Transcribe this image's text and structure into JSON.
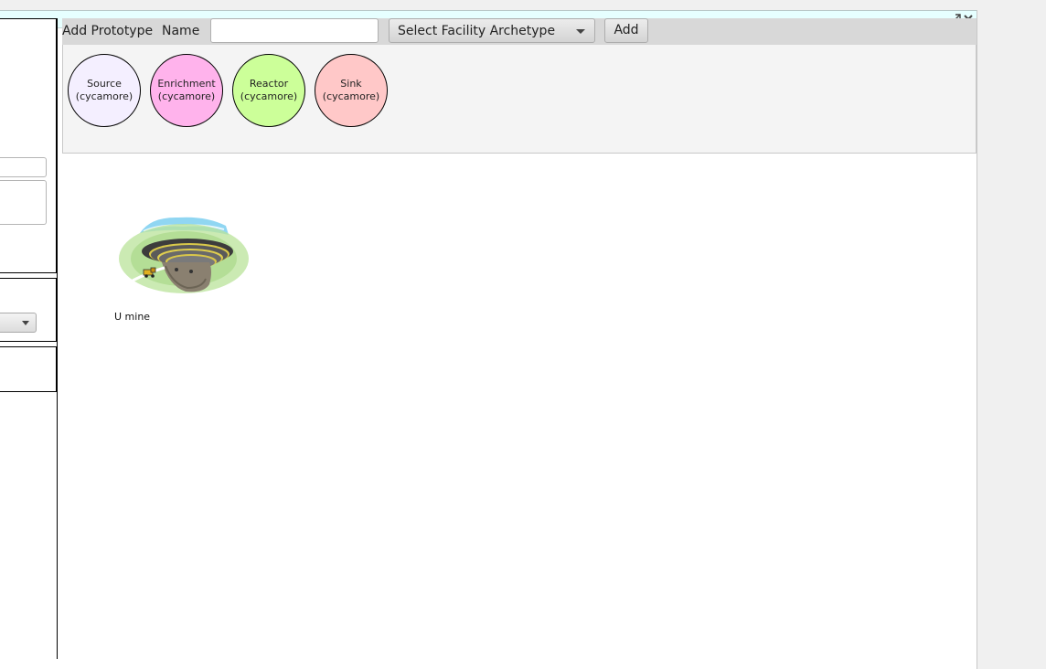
{
  "toolbar": {
    "add_prototype_label": "Add Prototype",
    "name_label": "Name",
    "name_input_value": "",
    "archetype_select_value": "Select Facility Archetype",
    "add_button_label": "Add"
  },
  "archetypes": [
    {
      "name": "Source",
      "library": "(cycamore)",
      "color": "#f4efff"
    },
    {
      "name": "Enrichment",
      "library": "(cycamore)",
      "color": "#ffb3ec"
    },
    {
      "name": "Reactor",
      "library": "(cycamore)",
      "color": "#ccff99"
    },
    {
      "name": "Sink",
      "library": "(cycamore)",
      "color": "#ffc8c8"
    }
  ],
  "canvas": {
    "facilities": [
      {
        "label": "U mine",
        "icon": "open-pit-mine-icon"
      }
    ]
  },
  "window": {
    "titlebar_color": "#e6ffff",
    "icons": [
      "expand-icon",
      "close-icon"
    ]
  }
}
